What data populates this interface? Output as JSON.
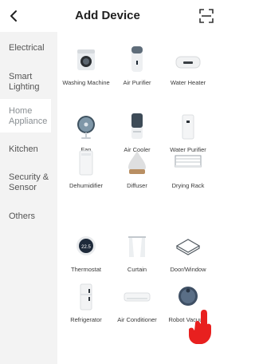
{
  "header": {
    "title": "Add Device"
  },
  "sidebar": {
    "items": [
      {
        "label": "Electrical"
      },
      {
        "label": "Smart Lighting"
      },
      {
        "label": "Home Appliance"
      },
      {
        "label": "Kitchen"
      },
      {
        "label": "Security & Sensor"
      },
      {
        "label": "Others"
      }
    ],
    "active_index": 2
  },
  "devices": [
    {
      "label": "Washing Machine",
      "icon": "washing-machine-icon"
    },
    {
      "label": "Air Purifier",
      "icon": "air-purifier-icon"
    },
    {
      "label": "Water Heater",
      "icon": "water-heater-icon"
    },
    {
      "label": "Fan",
      "icon": "fan-icon"
    },
    {
      "label": "Air Cooler",
      "icon": "air-cooler-icon"
    },
    {
      "label": "Water Purifier",
      "icon": "water-purifier-icon"
    },
    {
      "label": "Dehumidifier",
      "icon": "dehumidifier-icon"
    },
    {
      "label": "Diffuser",
      "icon": "diffuser-icon"
    },
    {
      "label": "Drying Rack",
      "icon": "drying-rack-icon"
    },
    {
      "label": "Thermostat",
      "icon": "thermostat-icon",
      "readout": "22.5"
    },
    {
      "label": "Curtain",
      "icon": "curtain-icon"
    },
    {
      "label": "Door/Window",
      "icon": "door-window-icon"
    },
    {
      "label": "Refrigerator",
      "icon": "refrigerator-icon"
    },
    {
      "label": "Air Conditioner",
      "icon": "air-conditioner-icon"
    },
    {
      "label": "Robot Vacuum",
      "icon": "robot-vacuum-icon"
    }
  ],
  "colors": {
    "accent_red": "#e8201f",
    "sidebar_bg": "#f3f3f3",
    "active_text": "#8a8f93"
  }
}
